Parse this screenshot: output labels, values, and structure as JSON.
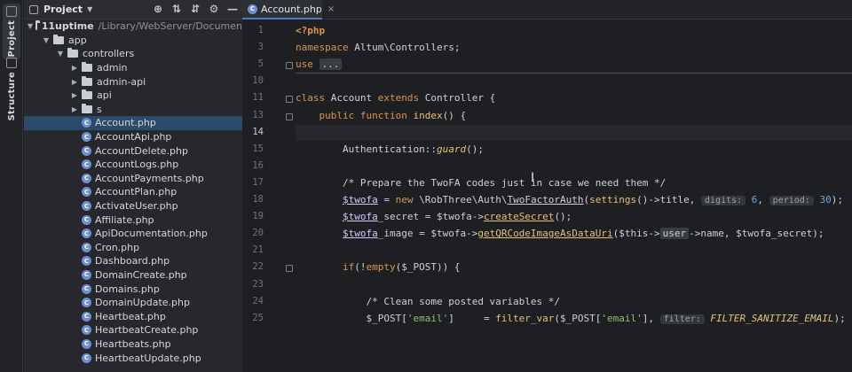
{
  "tool_strip": {
    "project_label": "Project",
    "structure_label": "Structure"
  },
  "project_panel": {
    "title": "Project",
    "tools": [
      "⊕",
      "⇅",
      "⇵",
      "⚙",
      "—"
    ],
    "tree": [
      {
        "type": "folder",
        "depth": 0,
        "expanded": true,
        "name": "11uptime",
        "path": "/Library/WebServer/Documen",
        "bold": true
      },
      {
        "type": "folder",
        "depth": 1,
        "expanded": true,
        "name": "app"
      },
      {
        "type": "folder",
        "depth": 2,
        "expanded": true,
        "name": "controllers"
      },
      {
        "type": "folder",
        "depth": 3,
        "expanded": false,
        "name": "admin"
      },
      {
        "type": "folder",
        "depth": 3,
        "expanded": false,
        "name": "admin-api"
      },
      {
        "type": "folder",
        "depth": 3,
        "expanded": false,
        "name": "api"
      },
      {
        "type": "folder",
        "depth": 3,
        "expanded": false,
        "name": "s"
      },
      {
        "type": "file",
        "depth": 3,
        "name": "Account.php",
        "selected": true
      },
      {
        "type": "file",
        "depth": 3,
        "name": "AccountApi.php"
      },
      {
        "type": "file",
        "depth": 3,
        "name": "AccountDelete.php"
      },
      {
        "type": "file",
        "depth": 3,
        "name": "AccountLogs.php"
      },
      {
        "type": "file",
        "depth": 3,
        "name": "AccountPayments.php"
      },
      {
        "type": "file",
        "depth": 3,
        "name": "AccountPlan.php"
      },
      {
        "type": "file",
        "depth": 3,
        "name": "ActivateUser.php"
      },
      {
        "type": "file",
        "depth": 3,
        "name": "Affiliate.php"
      },
      {
        "type": "file",
        "depth": 3,
        "name": "ApiDocumentation.php"
      },
      {
        "type": "file",
        "depth": 3,
        "name": "Cron.php"
      },
      {
        "type": "file",
        "depth": 3,
        "name": "Dashboard.php"
      },
      {
        "type": "file",
        "depth": 3,
        "name": "DomainCreate.php"
      },
      {
        "type": "file",
        "depth": 3,
        "name": "Domains.php"
      },
      {
        "type": "file",
        "depth": 3,
        "name": "DomainUpdate.php"
      },
      {
        "type": "file",
        "depth": 3,
        "name": "Heartbeat.php"
      },
      {
        "type": "file",
        "depth": 3,
        "name": "HeartbeatCreate.php"
      },
      {
        "type": "file",
        "depth": 3,
        "name": "Heartbeats.php"
      },
      {
        "type": "file",
        "depth": 3,
        "name": "HeartbeatUpdate.php"
      }
    ]
  },
  "editor": {
    "tab_label": "Account.php",
    "tab_close": "×",
    "current_line": 14,
    "lines": [
      {
        "n": 1,
        "html": "<span class=\"tag\">&lt;?php</span>"
      },
      {
        "n": 3,
        "html": "<span class=\"kw\">namespace</span> Altum\\Controllers;"
      },
      {
        "n": 5,
        "html": "<span class=\"kw\">use</span> <span class=\"fold-box\">...</span>",
        "fold": true,
        "sep_after": true
      },
      {
        "n": 10,
        "html": ""
      },
      {
        "n": 11,
        "html": "<span class=\"kw\">class</span> Account <span class=\"kw\">extends</span> Controller {",
        "fold": true
      },
      {
        "n": 13,
        "html": "    <span class=\"kw\">public function</span> <span class=\"fn\">index</span>() {",
        "fold": true
      },
      {
        "n": 14,
        "html": ""
      },
      {
        "n": 15,
        "html": "        Authentication::<span class=\"it\">guard</span>();"
      },
      {
        "n": 16,
        "html": ""
      },
      {
        "n": 17,
        "html": "        <span class=\"cmt\">/* Prepare the TwoFA codes just in case we need them */</span>"
      },
      {
        "n": 18,
        "html": "        <span class=\"var ul\">$twofa</span> = <span class=\"kw\">new</span> \\RobThree\\Auth\\<span class=\"ul\">TwoFactorAuth</span>(<span class=\"fn\">settings</span>()->title, <span class=\"hint\">digits:</span> <span class=\"num\">6</span>, <span class=\"hint\">period:</span> <span class=\"num\">30</span>);"
      },
      {
        "n": 19,
        "html": "        <span class=\"var ul\">$twofa</span>_secret = $twofa-><span class=\"fn ul\">createSecret</span>();"
      },
      {
        "n": 20,
        "html": "        <span class=\"var ul\">$twofa</span>_image = $twofa-><span class=\"fn ul\">getQRCodeImageAsDataUri</span>($this-><span class=\"fold-box\">user</span>->name, $twofa_secret);"
      },
      {
        "n": 21,
        "html": ""
      },
      {
        "n": 22,
        "html": "        <span class=\"kw\">if</span>(!<span class=\"kw\">empty</span>($_POST)) {",
        "fold": true
      },
      {
        "n": 23,
        "html": ""
      },
      {
        "n": 24,
        "html": "            <span class=\"cmt\">/* Clean some posted variables */</span>"
      },
      {
        "n": 25,
        "html": "            $_POST[<span class=\"str\">'email'</span>]     = <span class=\"fn\">filter_var</span>($_POST[<span class=\"str\">'email'</span>], <span class=\"hint\">filter:</span> <span class=\"it\">FILTER_SANITIZE_EMAIL</span>);"
      }
    ]
  }
}
